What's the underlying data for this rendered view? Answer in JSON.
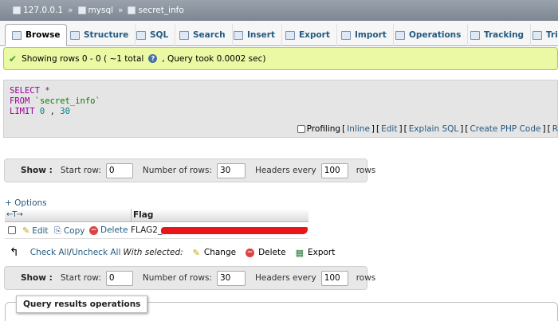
{
  "breadcrumb": {
    "server": "127.0.0.1",
    "database": "mysql",
    "table": "secret_info",
    "separator": "»"
  },
  "tabs": [
    {
      "label": "Browse",
      "icon": "browse-icon",
      "active": true
    },
    {
      "label": "Structure",
      "icon": "structure-icon"
    },
    {
      "label": "SQL",
      "icon": "sql-icon"
    },
    {
      "label": "Search",
      "icon": "search-icon"
    },
    {
      "label": "Insert",
      "icon": "insert-icon"
    },
    {
      "label": "Export",
      "icon": "export-icon"
    },
    {
      "label": "Import",
      "icon": "import-icon"
    },
    {
      "label": "Operations",
      "icon": "operations-icon"
    },
    {
      "label": "Tracking",
      "icon": "tracking-icon"
    },
    {
      "label": "Trig",
      "icon": "triggers-icon"
    }
  ],
  "notice": {
    "text_before": "Showing rows 0 - 0 ( ~1 total",
    "text_after": ", Query took 0.0002 sec)"
  },
  "sql": {
    "select_kw": "SELECT",
    "select_rest": " *",
    "from_kw": "FROM",
    "from_table": " `secret_info`",
    "limit_kw": "LIMIT",
    "limit_a": " 0",
    "limit_sep": " ,",
    "limit_b": " 30"
  },
  "sql_footer": {
    "profiling": "Profiling",
    "inline": "Inline",
    "edit": "Edit",
    "explain": "Explain SQL",
    "create_php": "Create PHP Code",
    "refresh_partial": "R"
  },
  "nav": {
    "show_label": "Show :",
    "start_row_label": "Start row:",
    "start_row_value": "0",
    "num_rows_label": "Number of rows:",
    "num_rows_value": "30",
    "headers_every_label": "Headers every",
    "headers_every_value": "100",
    "rows_label": "rows"
  },
  "options_link": "+ Options",
  "table": {
    "column_header": "Flag",
    "col_arrows": "←T→",
    "row": {
      "edit": "Edit",
      "copy": "Copy",
      "delete": "Delete",
      "flag_visible": "FLAG2_"
    }
  },
  "with_selected": {
    "check_all": "Check All",
    "slash": " / ",
    "uncheck_all": "Uncheck All",
    "label": "With selected:",
    "change": "Change",
    "delete": "Delete",
    "export": "Export"
  },
  "query_results_operations": "Query results operations",
  "colors": {
    "link": "#235a81",
    "success_bg": "#ebf8a4",
    "redaction": "#e8161b"
  }
}
